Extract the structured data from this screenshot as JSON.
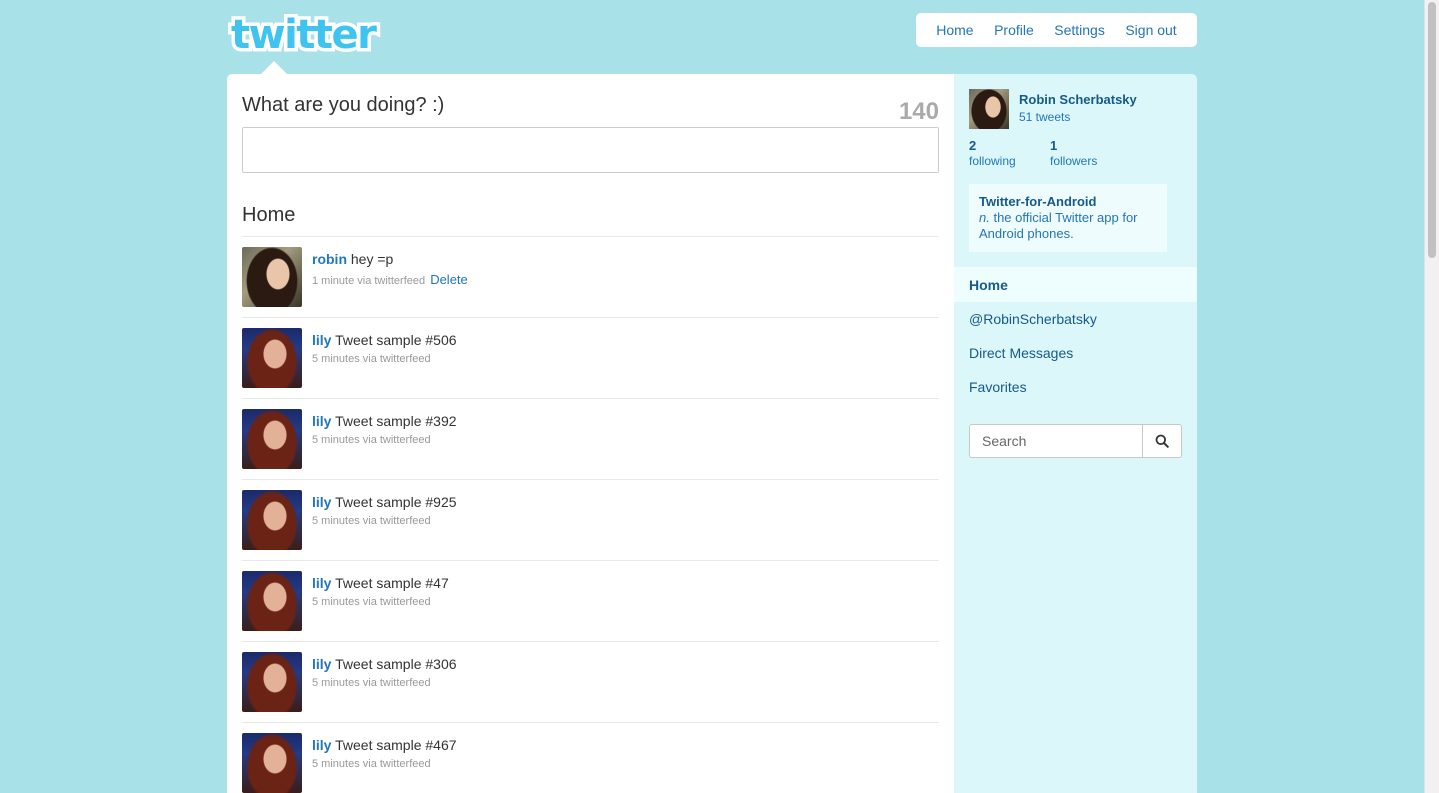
{
  "logo": {
    "text": "twitter"
  },
  "nav": {
    "home": "Home",
    "profile": "Profile",
    "settings": "Settings",
    "signout": "Sign out"
  },
  "composer": {
    "question": "What are you doing? :)",
    "counter": "140",
    "value": ""
  },
  "timeline": {
    "heading": "Home",
    "delete_label": "Delete",
    "tweets": [
      {
        "author": "robin",
        "text": "hey =p",
        "meta": "1 minute via twitterfeed",
        "avatar": "robin-avatar"
      },
      {
        "author": "lily",
        "text": "Tweet sample #506",
        "meta": "5 minutes via twitterfeed",
        "avatar": "lily-avatar"
      },
      {
        "author": "lily",
        "text": "Tweet sample #392",
        "meta": "5 minutes via twitterfeed",
        "avatar": "lily-avatar"
      },
      {
        "author": "lily",
        "text": "Tweet sample #925",
        "meta": "5 minutes via twitterfeed",
        "avatar": "lily-avatar"
      },
      {
        "author": "lily",
        "text": "Tweet sample #47",
        "meta": "5 minutes via twitterfeed",
        "avatar": "lily-avatar"
      },
      {
        "author": "lily",
        "text": "Tweet sample #306",
        "meta": "5 minutes via twitterfeed",
        "avatar": "lily-avatar"
      },
      {
        "author": "lily",
        "text": "Tweet sample #467",
        "meta": "5 minutes via twitterfeed",
        "avatar": "lily-avatar"
      }
    ]
  },
  "sidebar": {
    "profile": {
      "name": "Robin Scherbatsky",
      "tweets": "51 tweets"
    },
    "stats": {
      "following_count": "2",
      "following_label": "following",
      "followers_count": "1",
      "followers_label": "followers"
    },
    "promo": {
      "title": "Twitter-for-Android",
      "abbr": "n.",
      "text": " the official Twitter app for Android phones."
    },
    "nav": [
      "Home",
      "@RobinScherbatsky",
      "Direct Messages",
      "Favorites"
    ],
    "search": {
      "placeholder": "Search",
      "icon": "search-icon"
    }
  },
  "colors": {
    "background": "#a9e1e9",
    "link": "#2276bb",
    "sidebar": "#dbf7fa",
    "logo": "#3ec4ef"
  }
}
